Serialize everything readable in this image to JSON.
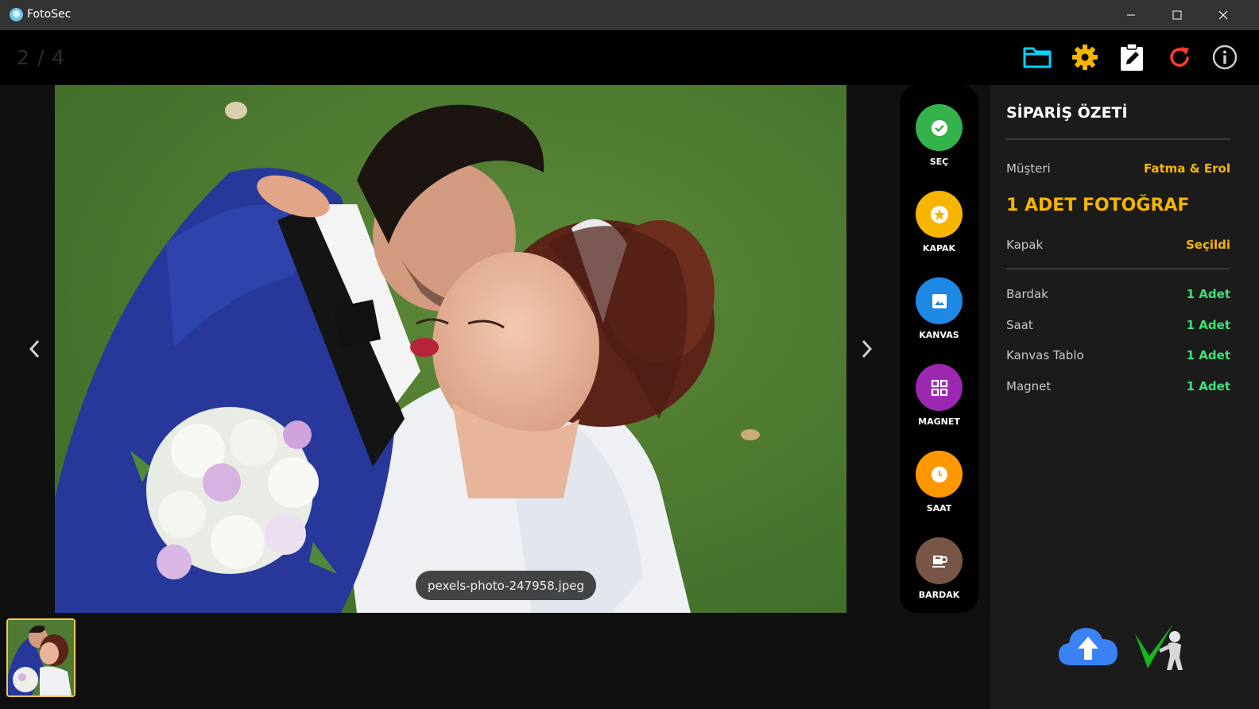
{
  "window": {
    "title": "FotoSec"
  },
  "toolbar": {
    "counter": "2 / 4",
    "buttons": [
      {
        "name": "folder-icon",
        "color": "#00d4ff"
      },
      {
        "name": "gear-icon",
        "color": "#f7b500"
      },
      {
        "name": "clipboard-edit-icon",
        "color": "#ffffff"
      },
      {
        "name": "refresh-icon",
        "color": "#ff3b30"
      },
      {
        "name": "info-icon",
        "color": "#cccccc"
      }
    ]
  },
  "viewer": {
    "filename": "pexels-photo-247958.jpeg"
  },
  "options": [
    {
      "label": "SEÇ",
      "color": "#34b34a",
      "icon": "check-icon"
    },
    {
      "label": "KAPAK",
      "color": "#f7b500",
      "icon": "star-icon"
    },
    {
      "label": "KANVAS",
      "color": "#1e88e5",
      "icon": "image-icon"
    },
    {
      "label": "MAGNET",
      "color": "#9c27b0",
      "icon": "grid-icon"
    },
    {
      "label": "SAAT",
      "color": "#ff9800",
      "icon": "clock-icon"
    },
    {
      "label": "BARDAK",
      "color": "#795548",
      "icon": "cup-icon"
    }
  ],
  "summary": {
    "title": "SİPARİŞ ÖZETİ",
    "customer_label": "Müşteri",
    "customer_value": "Fatma & Erol",
    "photo_count": "1 ADET FOTOĞRAF",
    "cover_label": "Kapak",
    "cover_value": "Seçildi",
    "items": [
      {
        "label": "Bardak",
        "value": "1 Adet"
      },
      {
        "label": "Saat",
        "value": "1 Adet"
      },
      {
        "label": "Kanvas Tablo",
        "value": "1 Adet"
      },
      {
        "label": "Magnet",
        "value": "1 Adet"
      }
    ]
  },
  "colors": {
    "accent_yellow": "#f7b500",
    "accent_green": "#3fe07a",
    "upload_blue": "#3b82f6"
  }
}
